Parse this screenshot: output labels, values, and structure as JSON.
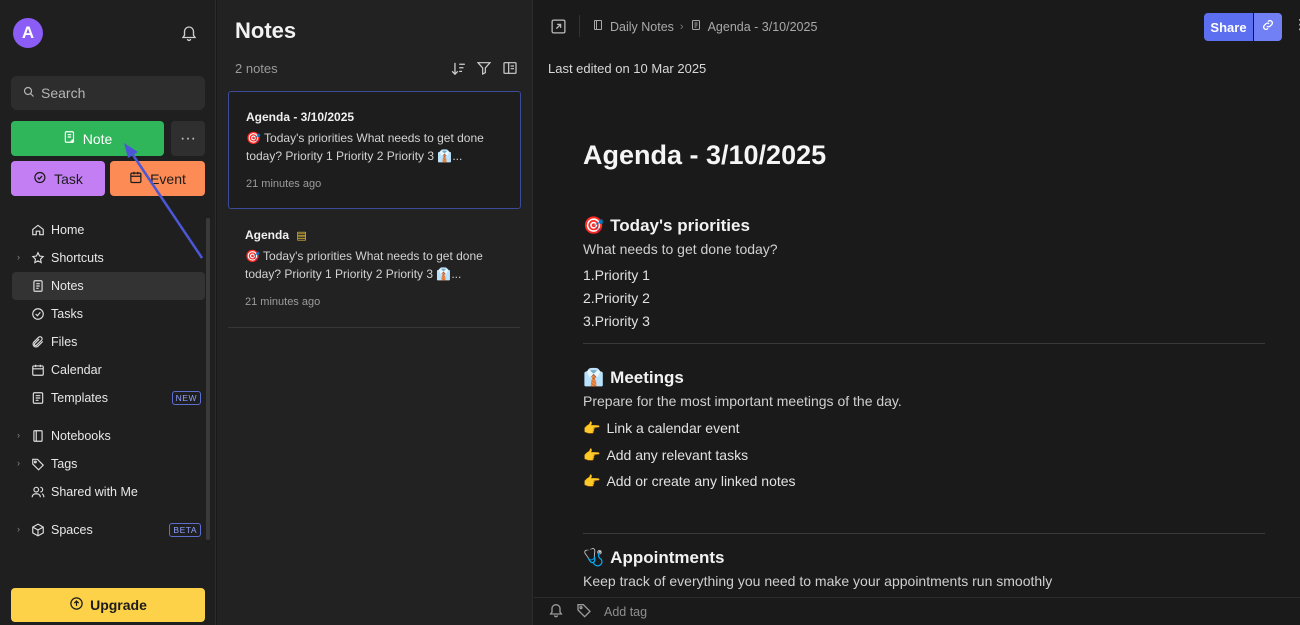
{
  "sidebar": {
    "avatar_initial": "A",
    "search_placeholder": "Search",
    "buttons": {
      "note": "Note",
      "more": "···",
      "task": "Task",
      "event": "Event",
      "upgrade": "Upgrade"
    },
    "nav": [
      {
        "label": "Home",
        "icon": "home-icon"
      },
      {
        "label": "Shortcuts",
        "icon": "star-icon",
        "expandable": true
      },
      {
        "label": "Notes",
        "icon": "note-icon",
        "active": true
      },
      {
        "label": "Tasks",
        "icon": "check-circle-icon"
      },
      {
        "label": "Files",
        "icon": "paperclip-icon"
      },
      {
        "label": "Calendar",
        "icon": "calendar-icon"
      },
      {
        "label": "Templates",
        "icon": "template-icon",
        "badge": "NEW"
      },
      {
        "label": "Notebooks",
        "icon": "notebook-icon",
        "expandable": true
      },
      {
        "label": "Tags",
        "icon": "tag-icon",
        "expandable": true
      },
      {
        "label": "Shared with Me",
        "icon": "users-icon"
      },
      {
        "label": "Spaces",
        "icon": "cube-icon",
        "expandable": true,
        "badge": "BETA"
      }
    ]
  },
  "notes_list": {
    "title": "Notes",
    "count": "2 notes",
    "items": [
      {
        "title": "Agenda - 3/10/2025",
        "snippet_line1": "🎯 Today's priorities What needs to get done",
        "snippet_line2": "today? Priority 1 Priority 2 Priority 3 👔...",
        "time": "21 minutes ago"
      },
      {
        "title": "Agenda",
        "snippet_line1": "🎯 Today's priorities What needs to get done",
        "snippet_line2": "today? Priority 1 Priority 2 Priority 3 👔...",
        "time": "21 minutes ago"
      }
    ]
  },
  "editor": {
    "breadcrumb": {
      "notebook": "Daily Notes",
      "note": "Agenda - 3/10/2025"
    },
    "share_label": "Share",
    "last_edited": "Last edited on 10 Mar 2025",
    "doc": {
      "title": "Agenda - 3/10/2025",
      "sections": [
        {
          "emoji": "🎯",
          "heading": "Today's priorities",
          "desc": "What needs to get done today?",
          "items": [
            "1.Priority 1",
            "2.Priority 2",
            "3.Priority 3"
          ]
        },
        {
          "emoji": "👔",
          "heading": "Meetings",
          "desc": "Prepare for the most important meetings of the day.",
          "items": [
            "Link a calendar event",
            "Add any relevant tasks",
            "Add or create any linked notes"
          ]
        },
        {
          "emoji": "🩺",
          "heading": "Appointments",
          "desc": "Keep track of everything you need to make your appointments run smoothly"
        }
      ]
    },
    "add_tag_placeholder": "Add tag"
  },
  "colors": {
    "accent": "#5b6ff0",
    "note_button": "#2fb65a",
    "task_button": "#c47ef4",
    "event_button": "#fc8b55",
    "upgrade_button": "#fdd148",
    "annotation_arrow": "#4b57d6"
  }
}
